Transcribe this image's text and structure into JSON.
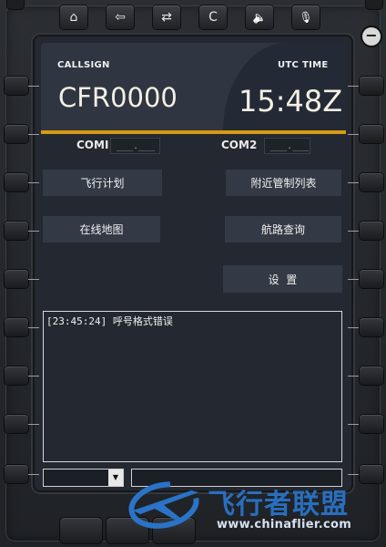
{
  "top_bar": {
    "buttons": [
      {
        "name": "home-icon",
        "glyph": "⌂"
      },
      {
        "name": "back-icon",
        "glyph": "⇦"
      },
      {
        "name": "swap-icon",
        "glyph": "⇄"
      },
      {
        "name": "clear-button",
        "glyph": "C"
      },
      {
        "name": "speaker-icon",
        "glyph": "🔈"
      },
      {
        "name": "microphone-icon",
        "glyph": "🎙"
      }
    ],
    "minus_glyph": "−"
  },
  "header": {
    "callsign_label": "CALLSIGN",
    "callsign_value": "CFR0000",
    "utc_label": "UTC TIME",
    "utc_value": "15:48Z"
  },
  "com": {
    "com1_label": "COMI",
    "com1_value": "___.___",
    "com2_label": "COM2",
    "com2_value": "___.___"
  },
  "menu": {
    "flight_plan": "飞行计划",
    "nearby_atc": "附近管制列表",
    "online_map": "在线地图",
    "route_query": "航路查询",
    "settings": "设  置"
  },
  "log": {
    "lines": [
      "[23:45:24] 呼号格式错误"
    ]
  },
  "input": {
    "select_value": "",
    "select_arrow": "▼",
    "command_value": ""
  },
  "watermark": {
    "text": "飞行者联盟",
    "url": "www.chinaflier.com"
  },
  "colors": {
    "accent_gold": "#d79a12",
    "header_bg": "#2f3541",
    "watermark_blue": "#2a73c7"
  }
}
